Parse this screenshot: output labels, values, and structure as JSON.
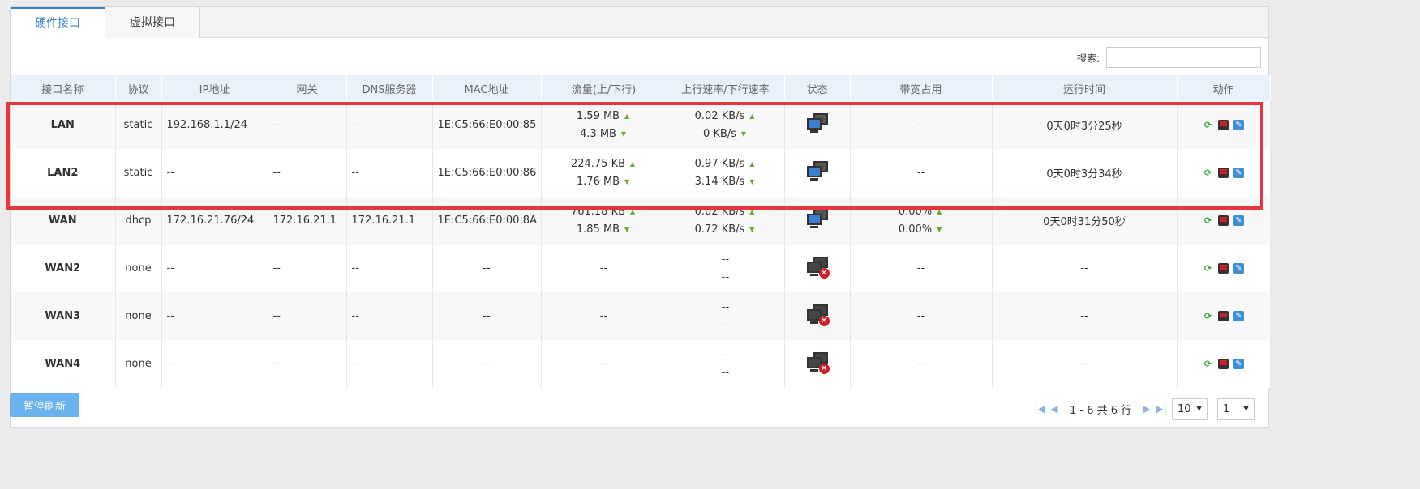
{
  "tabs": [
    {
      "label": "硬件接口",
      "active": true
    },
    {
      "label": "虚拟接口",
      "active": false
    }
  ],
  "search": {
    "label": "搜索:",
    "value": "",
    "placeholder": ""
  },
  "columns": [
    "接口名称",
    "协议",
    "IP地址",
    "网关",
    "DNS服务器",
    "MAC地址",
    "流量(上/下行)",
    "上行速率/下行速率",
    "状态",
    "带宽占用",
    "运行时间",
    "动作"
  ],
  "rows": [
    {
      "name": "LAN",
      "protocol": "static",
      "ip": "192.168.1.1/24",
      "gateway": "--",
      "dns": "--",
      "mac": "1E:C5:66:E0:00:85",
      "traffic_up": "1.59 MB",
      "traffic_down": "4.3 MB",
      "rate_up": "0.02 KB/s",
      "rate_down": "0 KB/s",
      "status": "connected",
      "bandwidth": "--",
      "bandwidth_up": "",
      "bandwidth_down": "",
      "uptime": "0天0时3分25秒"
    },
    {
      "name": "LAN2",
      "protocol": "static",
      "ip": "--",
      "gateway": "--",
      "dns": "--",
      "mac": "1E:C5:66:E0:00:86",
      "traffic_up": "224.75 KB",
      "traffic_down": "1.76 MB",
      "rate_up": "0.97 KB/s",
      "rate_down": "3.14 KB/s",
      "status": "connected",
      "bandwidth": "--",
      "bandwidth_up": "",
      "bandwidth_down": "",
      "uptime": "0天0时3分34秒"
    },
    {
      "name": "WAN",
      "protocol": "dhcp",
      "ip": "172.16.21.76/24",
      "gateway": "172.16.21.1",
      "dns": "172.16.21.1",
      "mac": "1E:C5:66:E0:00:8A",
      "traffic_up": "761.18 KB",
      "traffic_down": "1.85 MB",
      "rate_up": "0.02 KB/s",
      "rate_down": "0.72 KB/s",
      "status": "connected",
      "bandwidth": "",
      "bandwidth_up": "0.00%",
      "bandwidth_down": "0.00%",
      "uptime": "0天0时31分50秒"
    },
    {
      "name": "WAN2",
      "protocol": "none",
      "ip": "--",
      "gateway": "--",
      "dns": "--",
      "mac": "--",
      "traffic": "--",
      "rate_up": "--",
      "rate_down": "--",
      "status": "disconnected",
      "bandwidth": "--",
      "uptime": "--"
    },
    {
      "name": "WAN3",
      "protocol": "none",
      "ip": "--",
      "gateway": "--",
      "dns": "--",
      "mac": "--",
      "traffic": "--",
      "rate_up": "--",
      "rate_down": "--",
      "status": "disconnected",
      "bandwidth": "--",
      "uptime": "--"
    },
    {
      "name": "WAN4",
      "protocol": "none",
      "ip": "--",
      "gateway": "--",
      "dns": "--",
      "mac": "--",
      "traffic": "--",
      "rate_up": "--",
      "rate_down": "--",
      "status": "disconnected",
      "bandwidth": "--",
      "uptime": "--"
    }
  ],
  "icons": {
    "up_arrow": "up-arrow-icon",
    "down_arrow": "down-arrow-icon",
    "refresh": "refresh-icon",
    "monitor": "monitor-icon",
    "edit": "edit-icon",
    "status_ok": "network-connected-icon",
    "status_off": "network-disconnected-icon"
  },
  "footer": {
    "pause_label": "暂停刷新",
    "page_info": "1 - 6 共 6 行",
    "page_size": "10",
    "page_number": "1"
  },
  "colors": {
    "accent": "#3a7dc9",
    "highlight": "#e8343c",
    "header_bg": "#e9f2fa",
    "button": "#6ab3ee"
  }
}
